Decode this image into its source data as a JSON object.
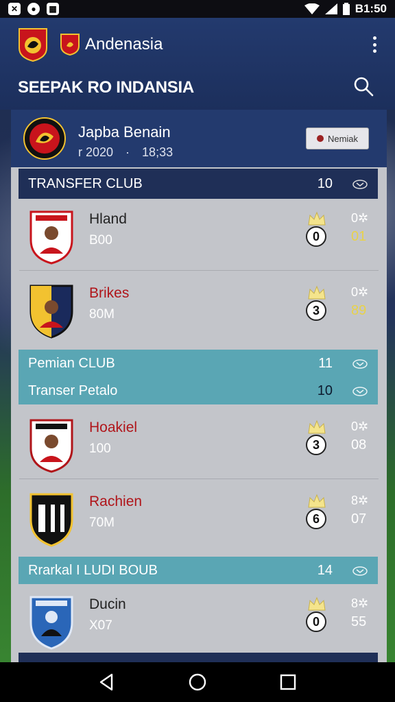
{
  "status_bar": {
    "time": "B1:50"
  },
  "app": {
    "name": "Andenasia",
    "title": "SEEPAK RO INDANSIA"
  },
  "profile": {
    "name": "Japba Benain",
    "date": "r 2020",
    "time": "18;33",
    "button_label": "Nemiak"
  },
  "sections": [
    {
      "label": "TRANSFER CLUB",
      "count": "10"
    },
    {
      "label": "Pemian CLUB",
      "count": "11"
    },
    {
      "label": "Transer Petalo",
      "count": "10"
    },
    {
      "label": "Rrarkal I LUDI BOUB",
      "count": "14"
    }
  ],
  "rows": [
    {
      "name": "Hland",
      "sub": "B00",
      "rank": "0",
      "stat1": "0✲",
      "stat2": "01"
    },
    {
      "name": "Brikes",
      "sub": "80M",
      "rank": "3",
      "stat1": "0✲",
      "stat2": "89"
    },
    {
      "name": "Hoakiel",
      "sub": "100",
      "rank": "3",
      "stat1": "0✲",
      "stat2": "08"
    },
    {
      "name": "Rachien",
      "sub": "70M",
      "rank": "6",
      "stat1": "8✲",
      "stat2": "07"
    },
    {
      "name": "Ducin",
      "sub": "X07",
      "rank": "0",
      "stat1": "8✲",
      "stat2": "55"
    }
  ],
  "icons": [
    "app-logo-icon",
    "team-logo-icon",
    "more-vert-icon",
    "search-icon",
    "chevron-down-icon",
    "crown-icon",
    "back-icon",
    "home-icon",
    "recents-icon"
  ],
  "colors": {
    "app_bar": "#233a6e",
    "section_dark": "#1f2f57",
    "section_teal": "#5aa6b4",
    "panel": "#c3c5ca",
    "accent_red": "#b0151a",
    "gold": "#e8d24a"
  }
}
